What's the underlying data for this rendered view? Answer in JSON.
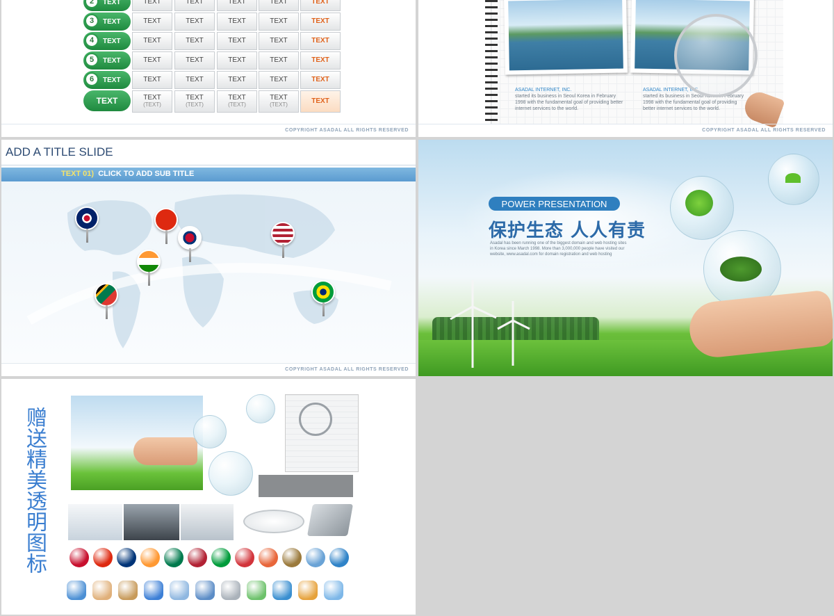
{
  "slide1": {
    "rows": [
      {
        "num": "2",
        "label": "TEXT",
        "cells": [
          "TEXT",
          "TEXT",
          "TEXT",
          "TEXT",
          "TEXT"
        ]
      },
      {
        "num": "3",
        "label": "TEXT",
        "cells": [
          "TEXT",
          "TEXT",
          "TEXT",
          "TEXT",
          "TEXT"
        ]
      },
      {
        "num": "4",
        "label": "TEXT",
        "cells": [
          "TEXT",
          "TEXT",
          "TEXT",
          "TEXT",
          "TEXT"
        ]
      },
      {
        "num": "5",
        "label": "TEXT",
        "cells": [
          "TEXT",
          "TEXT",
          "TEXT",
          "TEXT",
          "TEXT"
        ]
      },
      {
        "num": "6",
        "label": "TEXT",
        "cells": [
          "TEXT",
          "TEXT",
          "TEXT",
          "TEXT",
          "TEXT"
        ]
      }
    ],
    "last_row": {
      "label": "TEXT",
      "cell_main": "TEXT",
      "cell_sub": "(TEXT)",
      "orange": "TEXT"
    },
    "copyright": "COPYRIGHT ASADAL ALL RIGHTS RESERVED"
  },
  "slide2": {
    "caption_left_title": "ASADAL INTERNET, INC.",
    "caption_left_body": "started its business in Seoul Korea in February 1998 with the fundamental goal of providing better internet services to the world.",
    "caption_right_title": "ASADAL INTERNET, INC.",
    "caption_right_body": "started its business in Seoul Korea in February 1998 with the fundamental goal of providing better internet services to the world.",
    "copyright": "COPYRIGHT ASADAL ALL RIGHTS RESERVED"
  },
  "slide3": {
    "title": "ADD A TITLE SLIDE",
    "sub_prefix": "TEXT 01)",
    "sub_title": "CLICK TO ADD SUB TITLE",
    "copyright": "COPYRIGHT ASADAL ALL RIGHTS RESERVED"
  },
  "slide4": {
    "pill": "POWER PRESENTATION",
    "headline": "保护生态 人人有责",
    "body": "Asadal has been running one of the biggest domain and web hosting sites in Korea since March 1998. More than 3,000,000 people have visited our website, www.asadal.com for domain registration and web hosting"
  },
  "slide5": {
    "vertical_title": "赠送精美透明图标"
  },
  "colors": {
    "background": "#d4d4d4",
    "green_pill": "#2d9a4c",
    "blue_accent": "#2f7fbf",
    "orange_text": "#e0631c"
  }
}
